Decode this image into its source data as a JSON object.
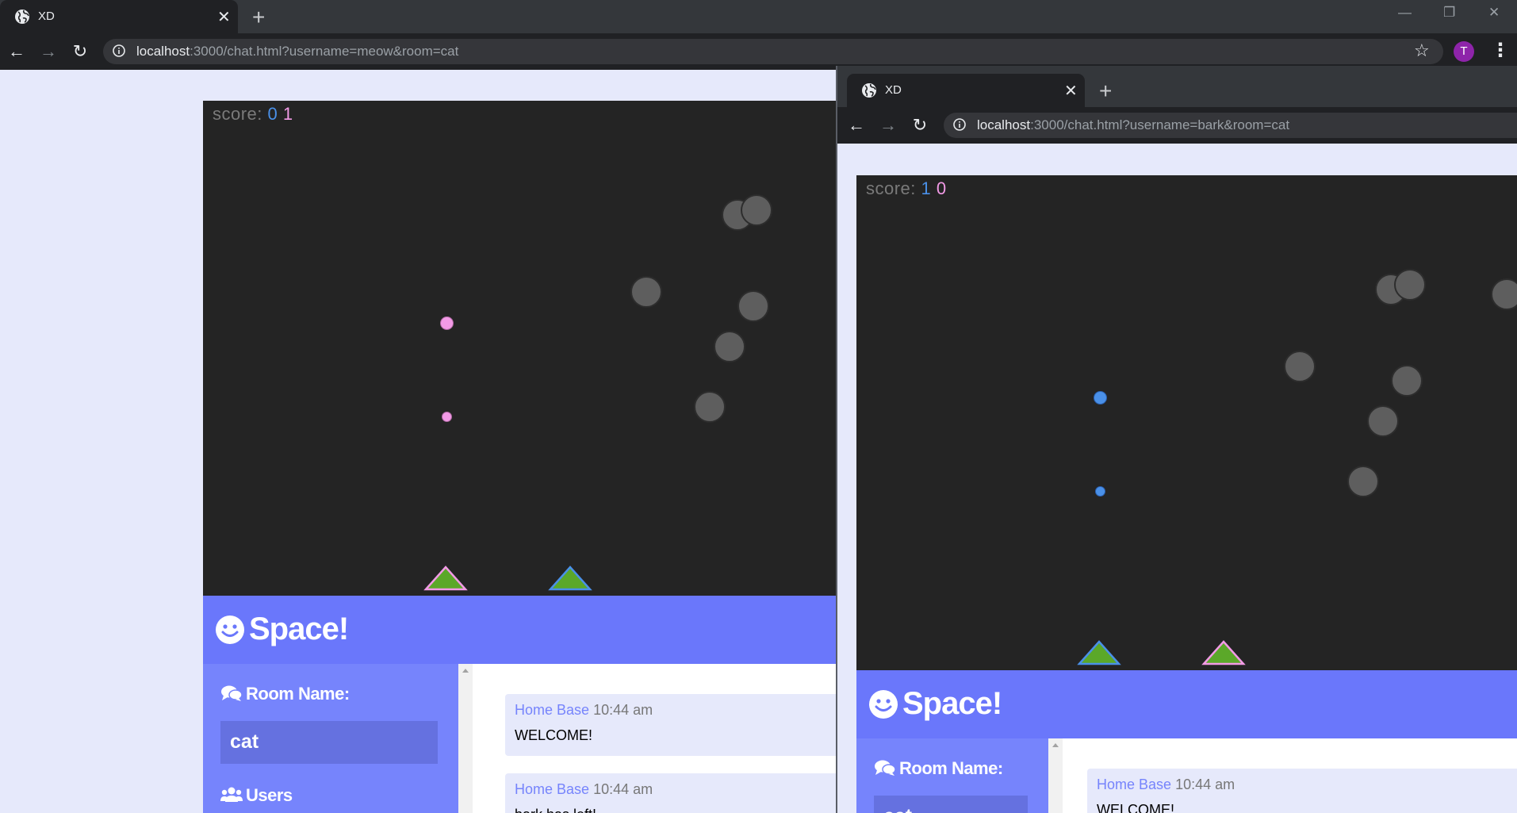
{
  "window1": {
    "tab": {
      "title": "XD",
      "icon": "globe-icon"
    },
    "url": {
      "host": "localhost",
      "path": ":3000/chat.html?username=meow&room=cat"
    },
    "profile_initial": "T",
    "game": {
      "score_label": "score:",
      "score_blue": "0",
      "score_pink": "1"
    },
    "app": {
      "brand": "Space!",
      "room_label": "Room Name:",
      "room_value": "cat",
      "users_label": "Users",
      "messages": [
        {
          "user": "Home Base",
          "time": "10:44 am",
          "text": "WELCOME!"
        },
        {
          "user": "Home Base",
          "time": "10:44 am",
          "text": "bark has left!"
        }
      ]
    }
  },
  "window2": {
    "tab": {
      "title": "XD",
      "icon": "globe-icon"
    },
    "url": {
      "host": "localhost",
      "path": ":3000/chat.html?username=bark&room=cat"
    },
    "game": {
      "score_label": "score:",
      "score_blue": "1",
      "score_pink": "0"
    },
    "app": {
      "brand": "Space!",
      "room_label": "Room Name:",
      "room_value": "cat",
      "messages": [
        {
          "user": "Home Base",
          "time": "10:44 am",
          "text": "WELCOME!"
        }
      ]
    }
  },
  "colors": {
    "page_bg": "#e6e9fb",
    "canvas_bg": "#242424",
    "header": "#6a77fb",
    "sidebar": "#7684fc",
    "room_input": "#6571e0",
    "ship_fill": "#5ba829",
    "player_blue": "#4a90e8",
    "player_pink": "#f29ae6",
    "asteroid": "#5e5e5e"
  }
}
